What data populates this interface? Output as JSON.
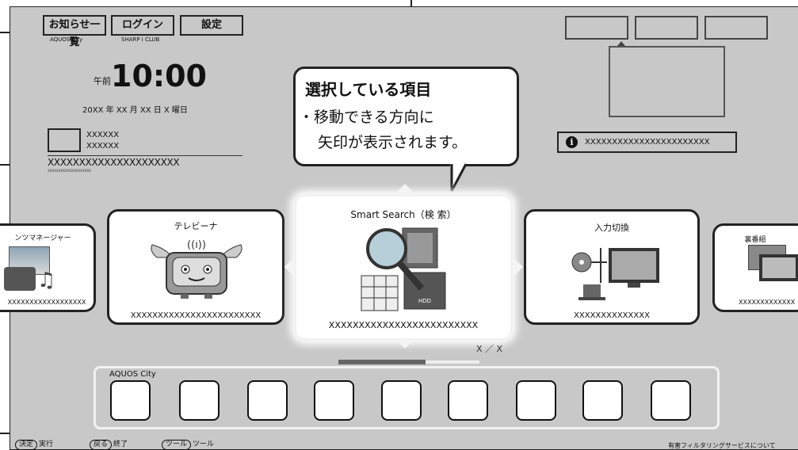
{
  "header": {
    "notice_button": "お知らせ一覧",
    "notice_sub": "AQUOS City",
    "login_button": "ログイン",
    "login_sub": "SHARP i CLUB",
    "settings_button": "設定"
  },
  "clock": {
    "ampm": "午前",
    "time": "10:00",
    "date": "20XX 年 XX 月 XX 日 X 曜日"
  },
  "info": {
    "line1": "XXXXXX",
    "line2": "XXXXXX",
    "program": "XXXXXXXXXXXXXXXXXXXXX",
    "program_small": "XXXXXXXXXXXXXXXXXXXX",
    "notification": "XXXXXXXXXXXXXXXXXXXXXXX"
  },
  "callout": {
    "title": "選択している項目",
    "line1": "・移動できる方向に",
    "line2": "矢印が表示されます。"
  },
  "cards": {
    "far_left_title": "ンツマネージャー",
    "far_left_sub": "XXXXXXXXXXXXXXXXXX",
    "left_title": "テレビーナ",
    "left_sub": "XXXXXXXXXXXXXXXXXXXXXXXX",
    "center_title": "Smart Search（検 索）",
    "center_sub": "XXXXXXXXXXXXXXXXXXXXXXXXX",
    "right_title": "入力切換",
    "right_sub": "XXXXXXXXXXXXXX",
    "far_right_title": "裏番組",
    "far_right_sub": "XXXXXXXXXXXXX"
  },
  "pager": "X ／ X",
  "city": {
    "label": "AQUOS City"
  },
  "footer": {
    "ok_key": "決定",
    "ok_label": "実行",
    "back_key": "戻る",
    "back_label": "終了",
    "tool_key": "ツール",
    "tool_label": "ツール",
    "filter_link": "有害フィルタリングサービスについて"
  },
  "colors": {
    "screen_bg": "#c8c8c8",
    "card_bg": "#ffffff",
    "outline": "#222222"
  }
}
